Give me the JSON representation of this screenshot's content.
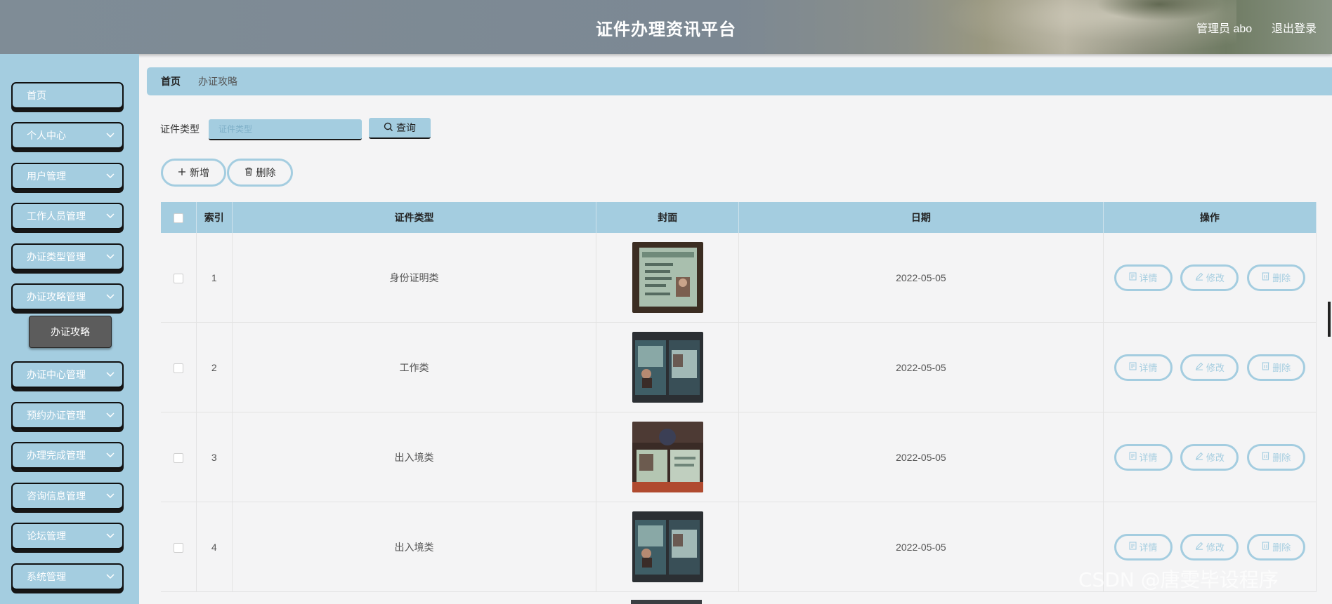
{
  "header": {
    "title": "证件办理资讯平台",
    "user": "管理员 abo",
    "logout": "退出登录"
  },
  "sidebar": {
    "items": [
      {
        "label": "首页",
        "has_chevron": false
      },
      {
        "label": "个人中心",
        "has_chevron": true
      },
      {
        "label": "用户管理",
        "has_chevron": true
      },
      {
        "label": "工作人员管理",
        "has_chevron": true
      },
      {
        "label": "办证类型管理",
        "has_chevron": true
      },
      {
        "label": "办证攻略管理",
        "has_chevron": true
      },
      {
        "label": "办证中心管理",
        "has_chevron": true
      },
      {
        "label": "预约办证管理",
        "has_chevron": true
      },
      {
        "label": "办理完成管理",
        "has_chevron": true
      },
      {
        "label": "咨询信息管理",
        "has_chevron": true
      },
      {
        "label": "论坛管理",
        "has_chevron": true
      },
      {
        "label": "系统管理",
        "has_chevron": true
      }
    ],
    "active_sub": "办证攻略"
  },
  "breadcrumb": {
    "home": "首页",
    "current": "办证攻略"
  },
  "search": {
    "label": "证件类型",
    "placeholder": "证件类型",
    "button": "查询"
  },
  "actions": {
    "add": "新增",
    "delete": "删除"
  },
  "table": {
    "columns": [
      "索引",
      "证件类型",
      "封面",
      "日期",
      "操作"
    ],
    "rows": [
      {
        "index": "1",
        "type": "身份证明类",
        "date": "2022-05-05"
      },
      {
        "index": "2",
        "type": "工作类",
        "date": "2022-05-05"
      },
      {
        "index": "3",
        "type": "出入境类",
        "date": "2022-05-05"
      },
      {
        "index": "4",
        "type": "出入境类",
        "date": "2022-05-05"
      }
    ],
    "row_actions": {
      "detail": "详情",
      "edit": "修改",
      "delete": "删除"
    }
  },
  "watermark": "CSDN @唐雯毕设程序",
  "colors": {
    "accent": "#a4cde0",
    "sidebar_active": "#5c5c5c",
    "page_bg": "#f4f4f5"
  }
}
